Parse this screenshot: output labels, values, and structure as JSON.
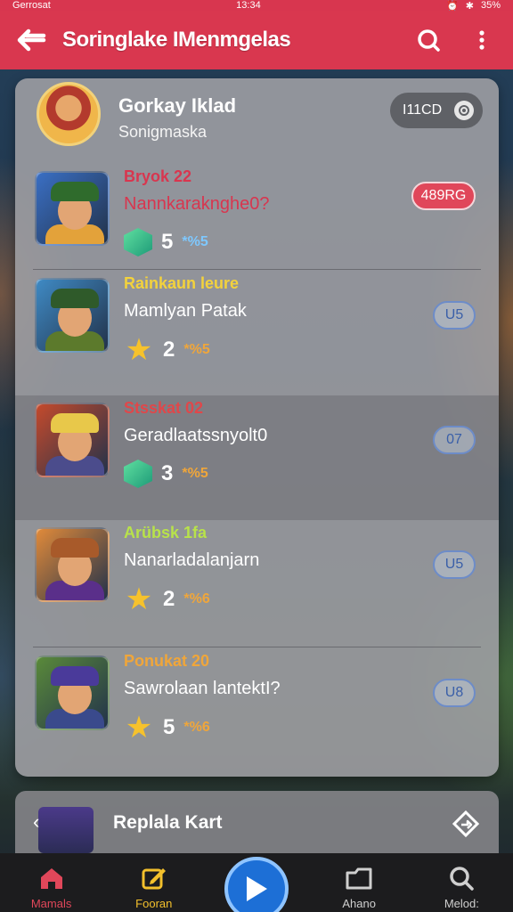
{
  "status": {
    "left": "Gerrosat",
    "center": "13:34",
    "battery": "35%"
  },
  "header": {
    "title": "Soringlake IMenmgelas",
    "back_icon": "back-arrow-icon",
    "search_icon": "search-icon",
    "menu_icon": "more-vert-icon"
  },
  "profile": {
    "name": "Gorkay Iklad",
    "subtitle": "Sonigmaska",
    "pill_label": "I11CD"
  },
  "items": [
    {
      "title": "Bryok 22",
      "title_color": "#d8364f",
      "subtitle": "Nannkaraknghe0?",
      "subtitle_color": "#d8364f",
      "count": "5",
      "rate": "*%5",
      "rate_color": "#7ec8ff",
      "icon": "gem",
      "badge": "489RG",
      "badge_style": "red",
      "hat": "#2f6b2c",
      "body": "#e3a23a",
      "bg": "#3a6fc4"
    },
    {
      "title": "Rainkaun leure",
      "title_color": "#f3d23c",
      "subtitle": "Mamlyan Patak",
      "subtitle_color": "#ffffff",
      "count": "2",
      "rate": "*%5",
      "rate_color": "#f0a63a",
      "icon": "star",
      "badge": "U5",
      "badge_style": "blue",
      "hat": "#2f5a2a",
      "body": "#5c7a2c",
      "bg": "#3f8ac4"
    },
    {
      "title": "Stsskat 02",
      "title_color": "#e0474a",
      "subtitle": "Geradlaatssnyolt0",
      "subtitle_color": "#ffffff",
      "count": "3",
      "rate": "*%5",
      "rate_color": "#f0a63a",
      "icon": "gem",
      "badge": "07",
      "badge_style": "blue",
      "hat": "#e8c84a",
      "body": "#4b4c8c",
      "bg": "#c44a2c"
    },
    {
      "title": "Arübsk 1fa",
      "title_color": "#b8e24a",
      "subtitle": "Nanarladalanjarn",
      "subtitle_color": "#ffffff",
      "count": "2",
      "rate": "*%6",
      "rate_color": "#f0a63a",
      "icon": "star",
      "badge": "U5",
      "badge_style": "blue",
      "hat": "#a85a2a",
      "body": "#5a2f8a",
      "bg": "#e08a3a"
    },
    {
      "title": "Ponukat 20",
      "title_color": "#f0a63a",
      "subtitle": "Sawrolaan lantektI?",
      "subtitle_color": "#ffffff",
      "count": "5",
      "rate": "*%6",
      "rate_color": "#f0a63a",
      "icon": "star",
      "badge": "U8",
      "badge_style": "blue",
      "hat": "#4a3a9a",
      "body": "#3a4a8c",
      "bg": "#5a8a3a"
    }
  ],
  "nowbar": {
    "label": "Replala Kart"
  },
  "nav": [
    {
      "label": "Mamals",
      "icon": "home-icon",
      "color": "#e0475a"
    },
    {
      "label": "Fooran",
      "icon": "edit-icon",
      "color": "#f3c02c"
    },
    {
      "label": "",
      "icon": "play-icon",
      "color": "#ffffff"
    },
    {
      "label": "Ahano",
      "icon": "folder-icon",
      "color": "#cfcfcf"
    },
    {
      "label": "Melod:",
      "icon": "search-icon",
      "color": "#cfcfcf"
    }
  ]
}
